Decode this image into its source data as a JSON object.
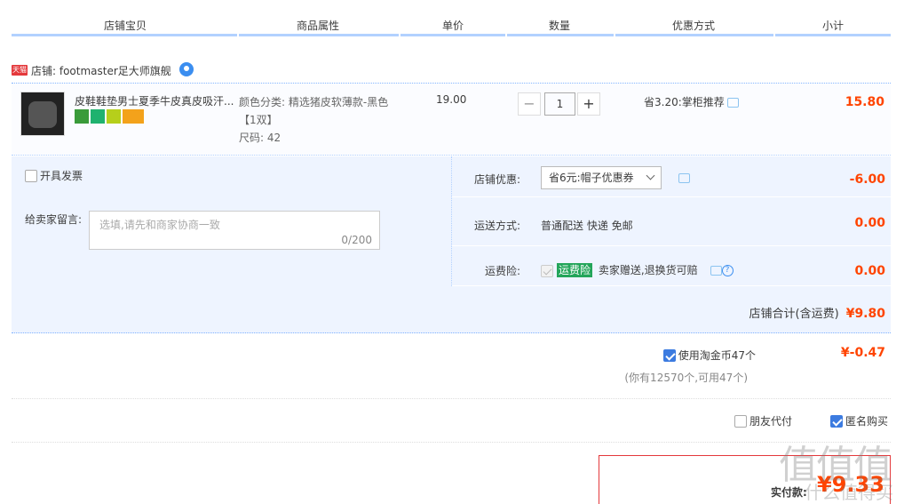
{
  "columns": [
    "店铺宝贝",
    "商品属性",
    "单价",
    "数量",
    "优惠方式",
    "小计"
  ],
  "shop": {
    "badge": "天猫",
    "label": "店铺: footmaster足大师旗舰",
    "ww_badge": "3"
  },
  "item": {
    "title": "皮鞋鞋垫男士夏季牛皮真皮吸汗...",
    "props_color": "颜色分类: 精选猪皮软薄款-黑色",
    "props_pack": "【1双】",
    "props_size": "尺码: 42",
    "unit_price": "19.00",
    "qty_minus": "−",
    "quantity": "1",
    "qty_plus": "+",
    "discount": "省3.20:掌柜推荐",
    "subtotal": "15.80"
  },
  "options": {
    "invoice_label": "开具发票",
    "message_label": "给卖家留言:",
    "message_placeholder": "选填,请先和商家协商一致",
    "message_count": "0/200",
    "shop_coupon_label": "店铺优惠:",
    "shop_coupon_value": "省6元:帽子优惠券",
    "shop_coupon_amount": "-6.00",
    "shipping_label": "运送方式:",
    "shipping_value": "普通配送 快递 免邮",
    "shipping_amount": "0.00",
    "insurance_label": "运费险:",
    "insurance_tag": "运费险",
    "insurance_text": "卖家赠送,退换货可赔",
    "insurance_help": "?",
    "insurance_amount": "0.00",
    "shop_total_label": "店铺合计(含运费)",
    "shop_total_value": "¥9.80"
  },
  "coins": {
    "label": "使用淘金币47个",
    "note": "(你有12570个,可用47个)",
    "amount": "¥-0.47",
    "checked": true
  },
  "pay_options": {
    "friend_pay": "朋友代付",
    "anonymous": "匿名购买",
    "anonymous_checked": true
  },
  "total": {
    "label": "实付款:",
    "amount": "¥9.33"
  },
  "watermark": {
    "big": "值值值",
    "small": "什么值得买"
  },
  "colors": {
    "accent_blue": "#3c7be0",
    "price_red": "#ff4400",
    "header_bar": "#b2d1ff",
    "options_bg": "#eef4ff"
  }
}
